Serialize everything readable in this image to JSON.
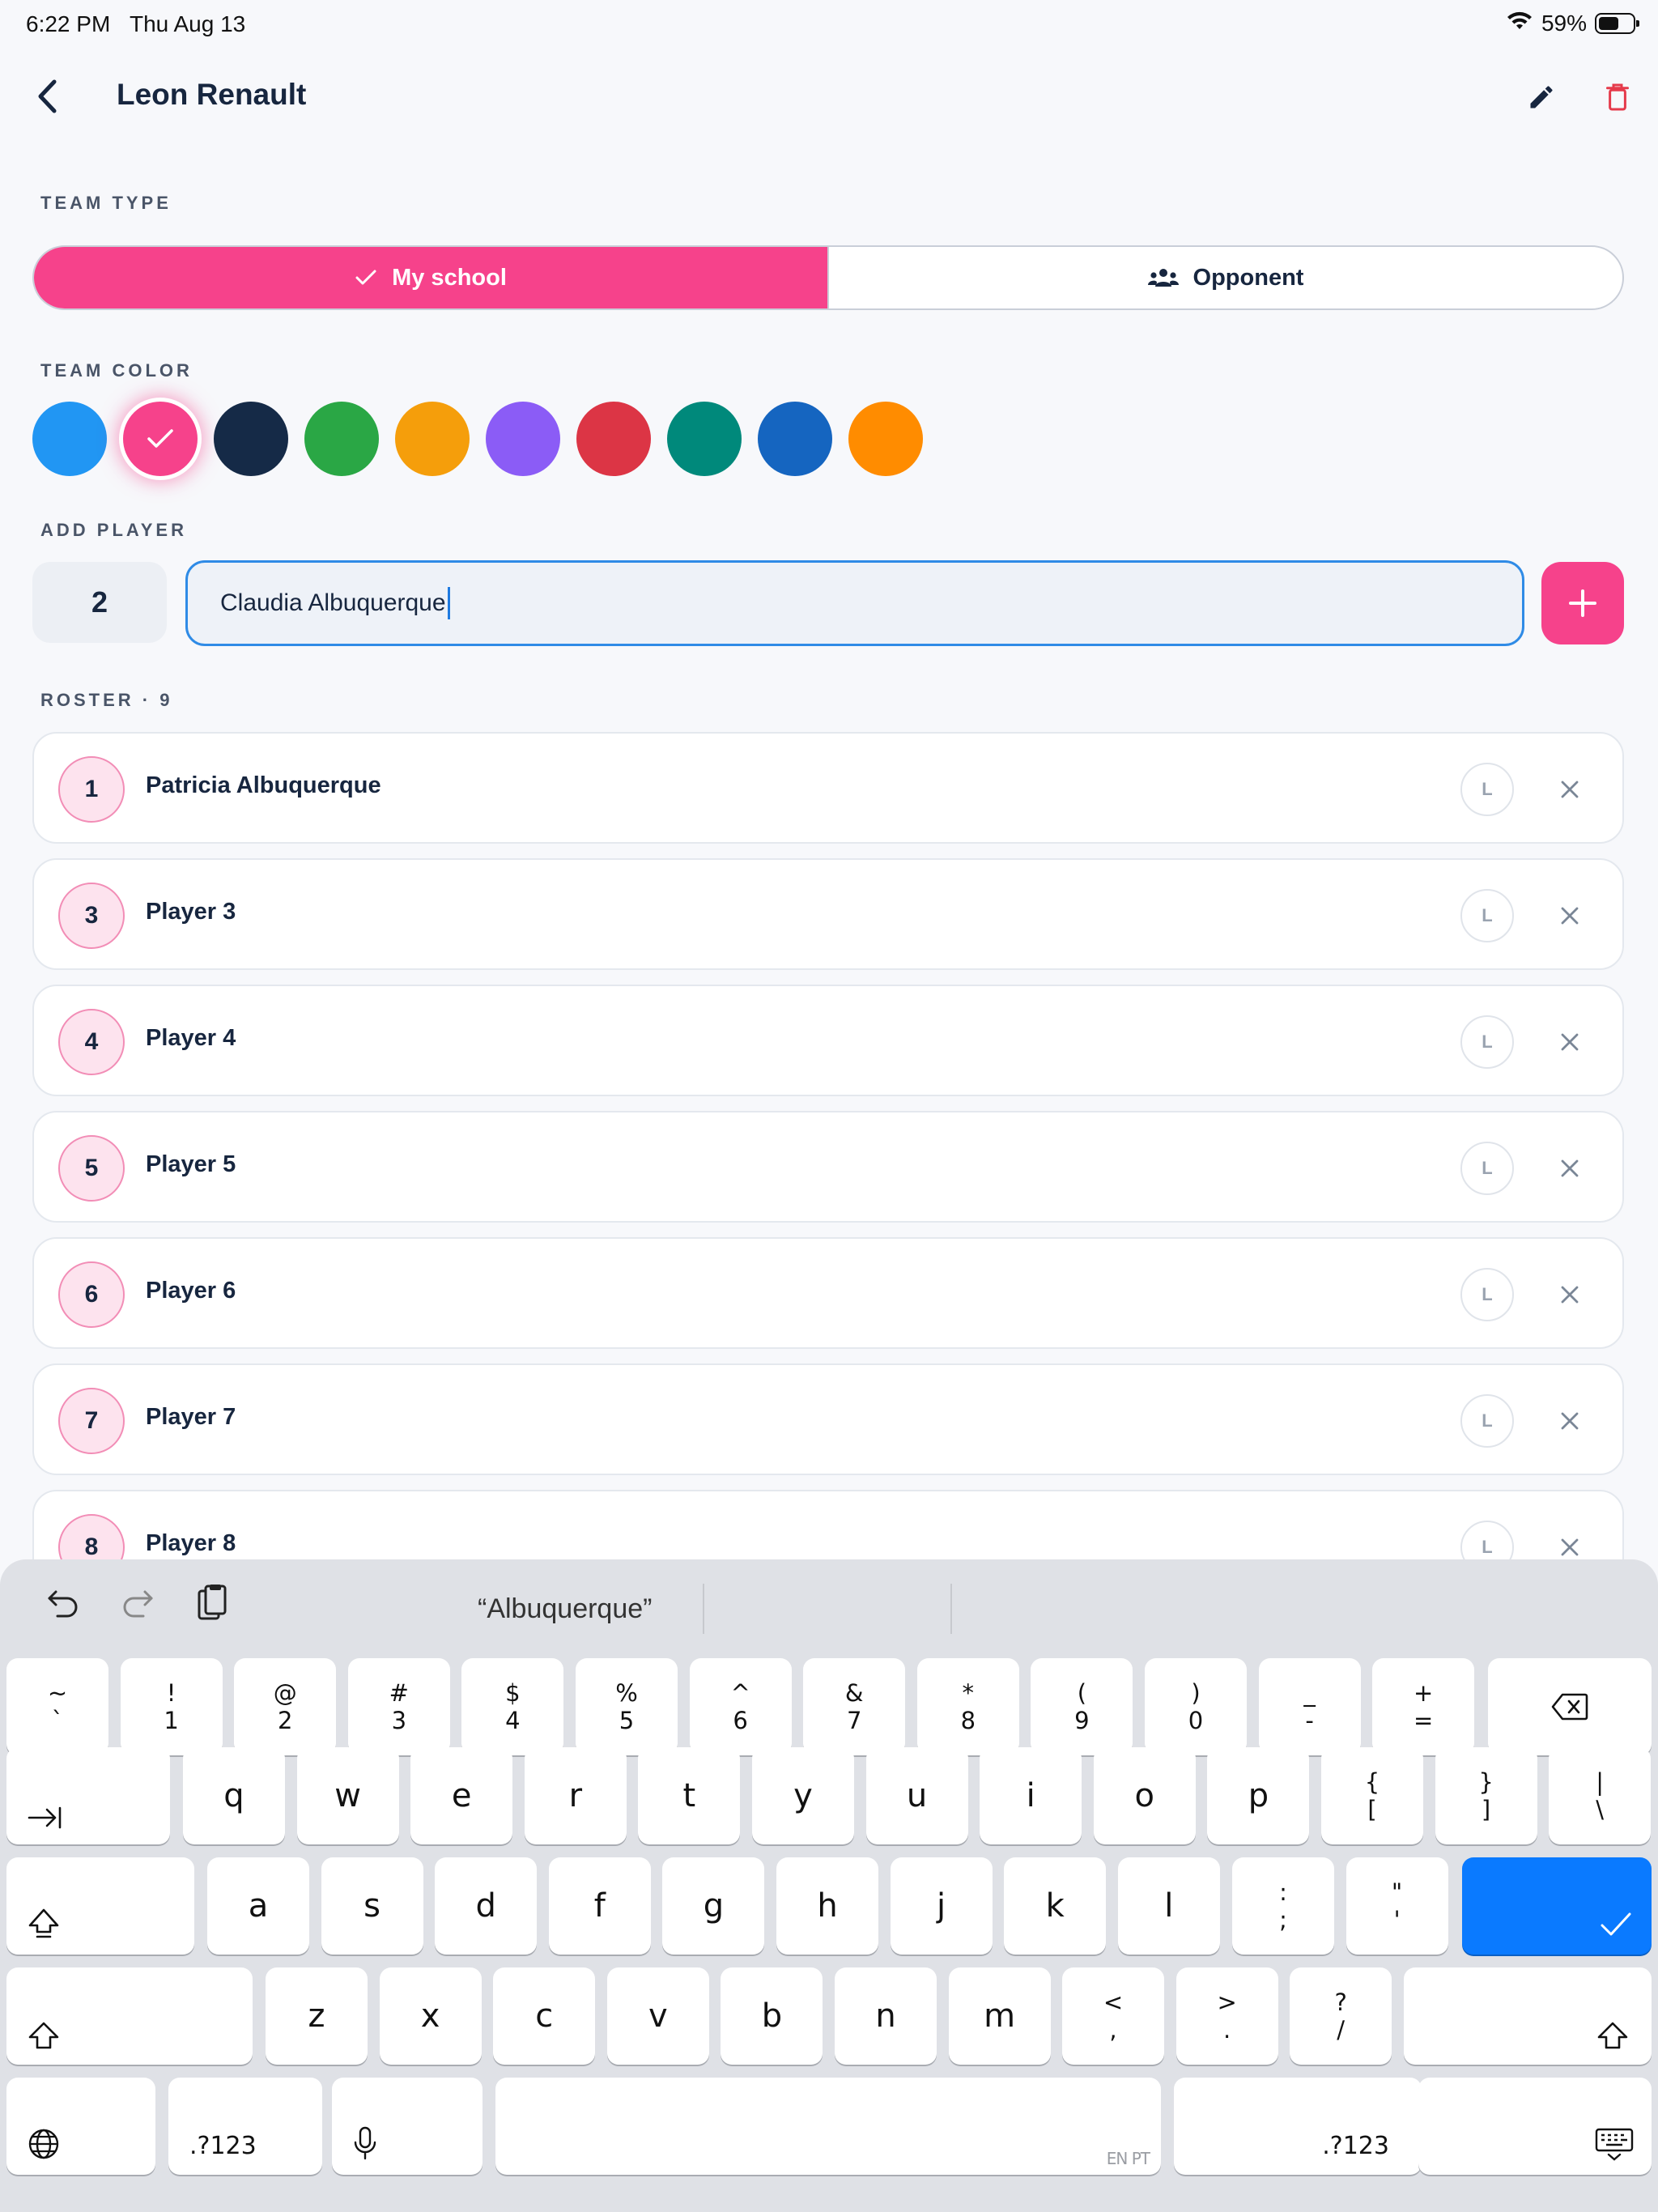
{
  "status_bar": {
    "time": "6:22 PM",
    "date": "Thu Aug 13",
    "battery": "59%"
  },
  "header": {
    "title": "Leon Renault"
  },
  "team_type": {
    "label": "TEAM TYPE",
    "options": [
      {
        "label": "My school",
        "selected": true
      },
      {
        "label": "Opponent",
        "selected": false
      }
    ]
  },
  "team_color": {
    "label": "TEAM COLOR",
    "colors": [
      "#2196f3",
      "#f6428b",
      "#152a47",
      "#2aa745",
      "#f59e0b",
      "#8b5cf6",
      "#dc3545",
      "#00897b",
      "#1565c0",
      "#ff8c00"
    ],
    "selected_index": 1
  },
  "add_player": {
    "label": "ADD PLAYER",
    "number": "2",
    "name_value": "Claudia Albuquerque"
  },
  "roster": {
    "label": "ROSTER · 9",
    "libero_label": "L",
    "players": [
      {
        "number": "1",
        "name": "Patricia Albuquerque"
      },
      {
        "number": "3",
        "name": "Player 3"
      },
      {
        "number": "4",
        "name": "Player 4"
      },
      {
        "number": "5",
        "name": "Player 5"
      },
      {
        "number": "6",
        "name": "Player 6"
      },
      {
        "number": "7",
        "name": "Player 7"
      },
      {
        "number": "8",
        "name": "Player 8"
      }
    ]
  },
  "keyboard": {
    "suggestion": "“Albuquerque”",
    "row1": [
      {
        "top": "~",
        "bottom": "`"
      },
      {
        "top": "!",
        "bottom": "1"
      },
      {
        "top": "@",
        "bottom": "2"
      },
      {
        "top": "#",
        "bottom": "3"
      },
      {
        "top": "$",
        "bottom": "4"
      },
      {
        "top": "%",
        "bottom": "5"
      },
      {
        "top": "^",
        "bottom": "6"
      },
      {
        "top": "&",
        "bottom": "7"
      },
      {
        "top": "*",
        "bottom": "8"
      },
      {
        "top": "(",
        "bottom": "9"
      },
      {
        "top": ")",
        "bottom": "0"
      },
      {
        "top": "_",
        "bottom": "-"
      },
      {
        "top": "+",
        "bottom": "="
      }
    ],
    "row2": [
      "q",
      "w",
      "e",
      "r",
      "t",
      "y",
      "u",
      "i",
      "o",
      "p"
    ],
    "row2_symbols": [
      {
        "top": "{",
        "bottom": "["
      },
      {
        "top": "}",
        "bottom": "]"
      },
      {
        "top": "|",
        "bottom": "\\"
      }
    ],
    "row3": [
      "a",
      "s",
      "d",
      "f",
      "g",
      "h",
      "j",
      "k",
      "l"
    ],
    "row3_symbols": [
      {
        "top": ":",
        "bottom": ";"
      },
      {
        "top": "\"",
        "bottom": "'"
      }
    ],
    "row4": [
      "z",
      "x",
      "c",
      "v",
      "b",
      "n",
      "m"
    ],
    "row4_symbols": [
      {
        "top": "<",
        "bottom": ","
      },
      {
        "top": ">",
        "bottom": "."
      },
      {
        "top": "?",
        "bottom": "/"
      }
    ],
    "numbers_label": ".?123",
    "language_hint": "EN PT"
  }
}
